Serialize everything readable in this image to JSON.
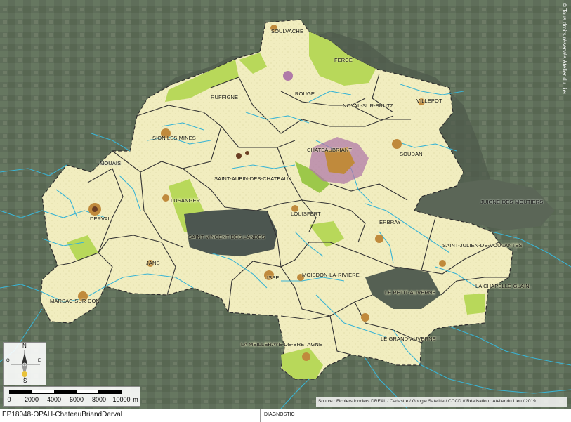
{
  "map": {
    "copyright": "© Tous droits réservés Atelier du Lieu",
    "source": "Source : Fichiers fonciers DREAL / Cadastre / Google Satellite / CCCD // Réalisation : Atelier du Lieu / 2019",
    "communes": [
      {
        "name": "SOULVACHE"
      },
      {
        "name": "FERCE"
      },
      {
        "name": "RUFFIGNE"
      },
      {
        "name": "ROUGE"
      },
      {
        "name": "NOYAL-SUR-BRUTZ"
      },
      {
        "name": "VILLEPOT"
      },
      {
        "name": "SION LES MINES"
      },
      {
        "name": "CHATEAUBRIANT"
      },
      {
        "name": "SOUDAN"
      },
      {
        "name": "MOUAIS"
      },
      {
        "name": "SAINT-AUBIN-DES-CHATEAUX"
      },
      {
        "name": "JUIGNE-DES-MOUTIERS"
      },
      {
        "name": "LUSANGER"
      },
      {
        "name": "LOUISFERT"
      },
      {
        "name": "ERBRAY"
      },
      {
        "name": "DERVAL"
      },
      {
        "name": "SAINT-VINCENT-DES-LANDES"
      },
      {
        "name": "SAINT-JULIEN-DE-VOUVANTES"
      },
      {
        "name": "JANS"
      },
      {
        "name": "ISSE"
      },
      {
        "name": "MOISDON-LA-RIVIERE"
      },
      {
        "name": "LA CHAPELLE-GLAIN"
      },
      {
        "name": "LE PETIT-AUVERNE"
      },
      {
        "name": "MARSAC-SUR-DON"
      },
      {
        "name": "LE GRAND-AUVERNE"
      },
      {
        "name": "LA MEILLERAYE-DE-BRETAGNE"
      }
    ],
    "compass": {
      "north": "N",
      "south": "S",
      "east": "E",
      "west": "O"
    },
    "scale": {
      "ticks": [
        "0",
        "2000",
        "4000",
        "6000",
        "8000",
        "10000"
      ],
      "unit": "m"
    },
    "colors": {
      "territory": "#f1edbf",
      "agricultural_green": "#b8d85a",
      "urban_core": "#c08a3c",
      "urban_dense": "#9a7aa0",
      "rivers": "#3ab4d4",
      "outside_satellite": "#5f6e5a"
    }
  },
  "footer": {
    "reference": "EP18048-OPAH-ChateauBriandDerval",
    "section": "DIAGNOSTIC"
  }
}
